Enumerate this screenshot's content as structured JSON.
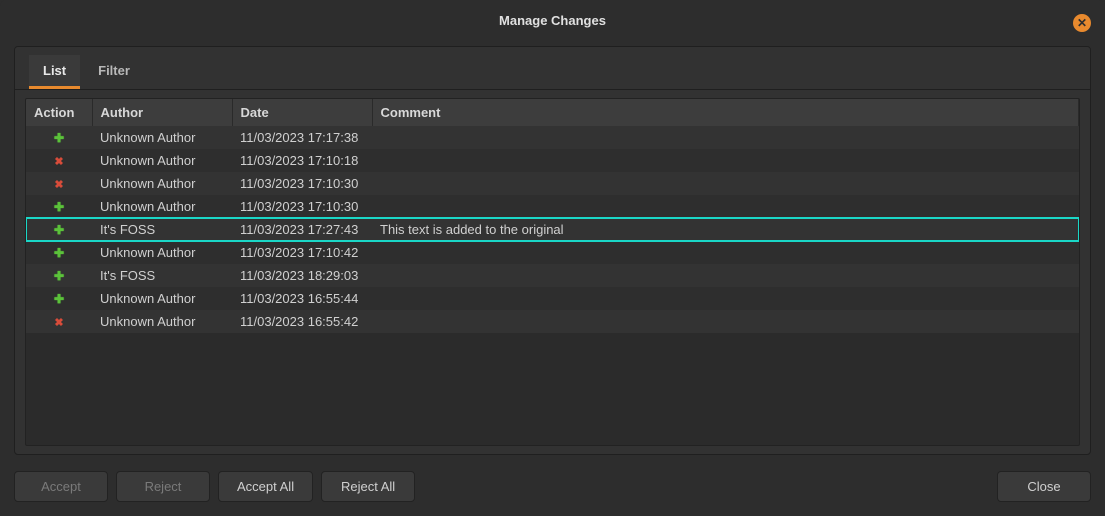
{
  "dialog": {
    "title": "Manage Changes"
  },
  "tabs": {
    "list": "List",
    "filter": "Filter"
  },
  "columns": {
    "action": "Action",
    "author": "Author",
    "date": "Date",
    "comment": "Comment"
  },
  "rows": [
    {
      "action": "plus",
      "author": "Unknown Author",
      "date": "11/03/2023 17:17:38",
      "comment": "",
      "highlighted": false
    },
    {
      "action": "cross",
      "author": "Unknown Author",
      "date": "11/03/2023 17:10:18",
      "comment": "",
      "highlighted": false
    },
    {
      "action": "cross",
      "author": "Unknown Author",
      "date": "11/03/2023 17:10:30",
      "comment": "",
      "highlighted": false
    },
    {
      "action": "plus",
      "author": "Unknown Author",
      "date": "11/03/2023 17:10:30",
      "comment": "",
      "highlighted": false
    },
    {
      "action": "plus",
      "author": "It's FOSS",
      "date": "11/03/2023 17:27:43",
      "comment": "This text is added to the original",
      "highlighted": true
    },
    {
      "action": "plus",
      "author": "Unknown Author",
      "date": "11/03/2023 17:10:42",
      "comment": "",
      "highlighted": false
    },
    {
      "action": "plus",
      "author": "It's FOSS",
      "date": "11/03/2023 18:29:03",
      "comment": "",
      "highlighted": false
    },
    {
      "action": "plus",
      "author": "Unknown Author",
      "date": "11/03/2023 16:55:44",
      "comment": "",
      "highlighted": false
    },
    {
      "action": "cross",
      "author": "Unknown Author",
      "date": "11/03/2023 16:55:42",
      "comment": "",
      "highlighted": false
    }
  ],
  "buttons": {
    "accept": "Accept",
    "reject": "Reject",
    "accept_all": "Accept All",
    "reject_all": "Reject All",
    "close": "Close"
  }
}
